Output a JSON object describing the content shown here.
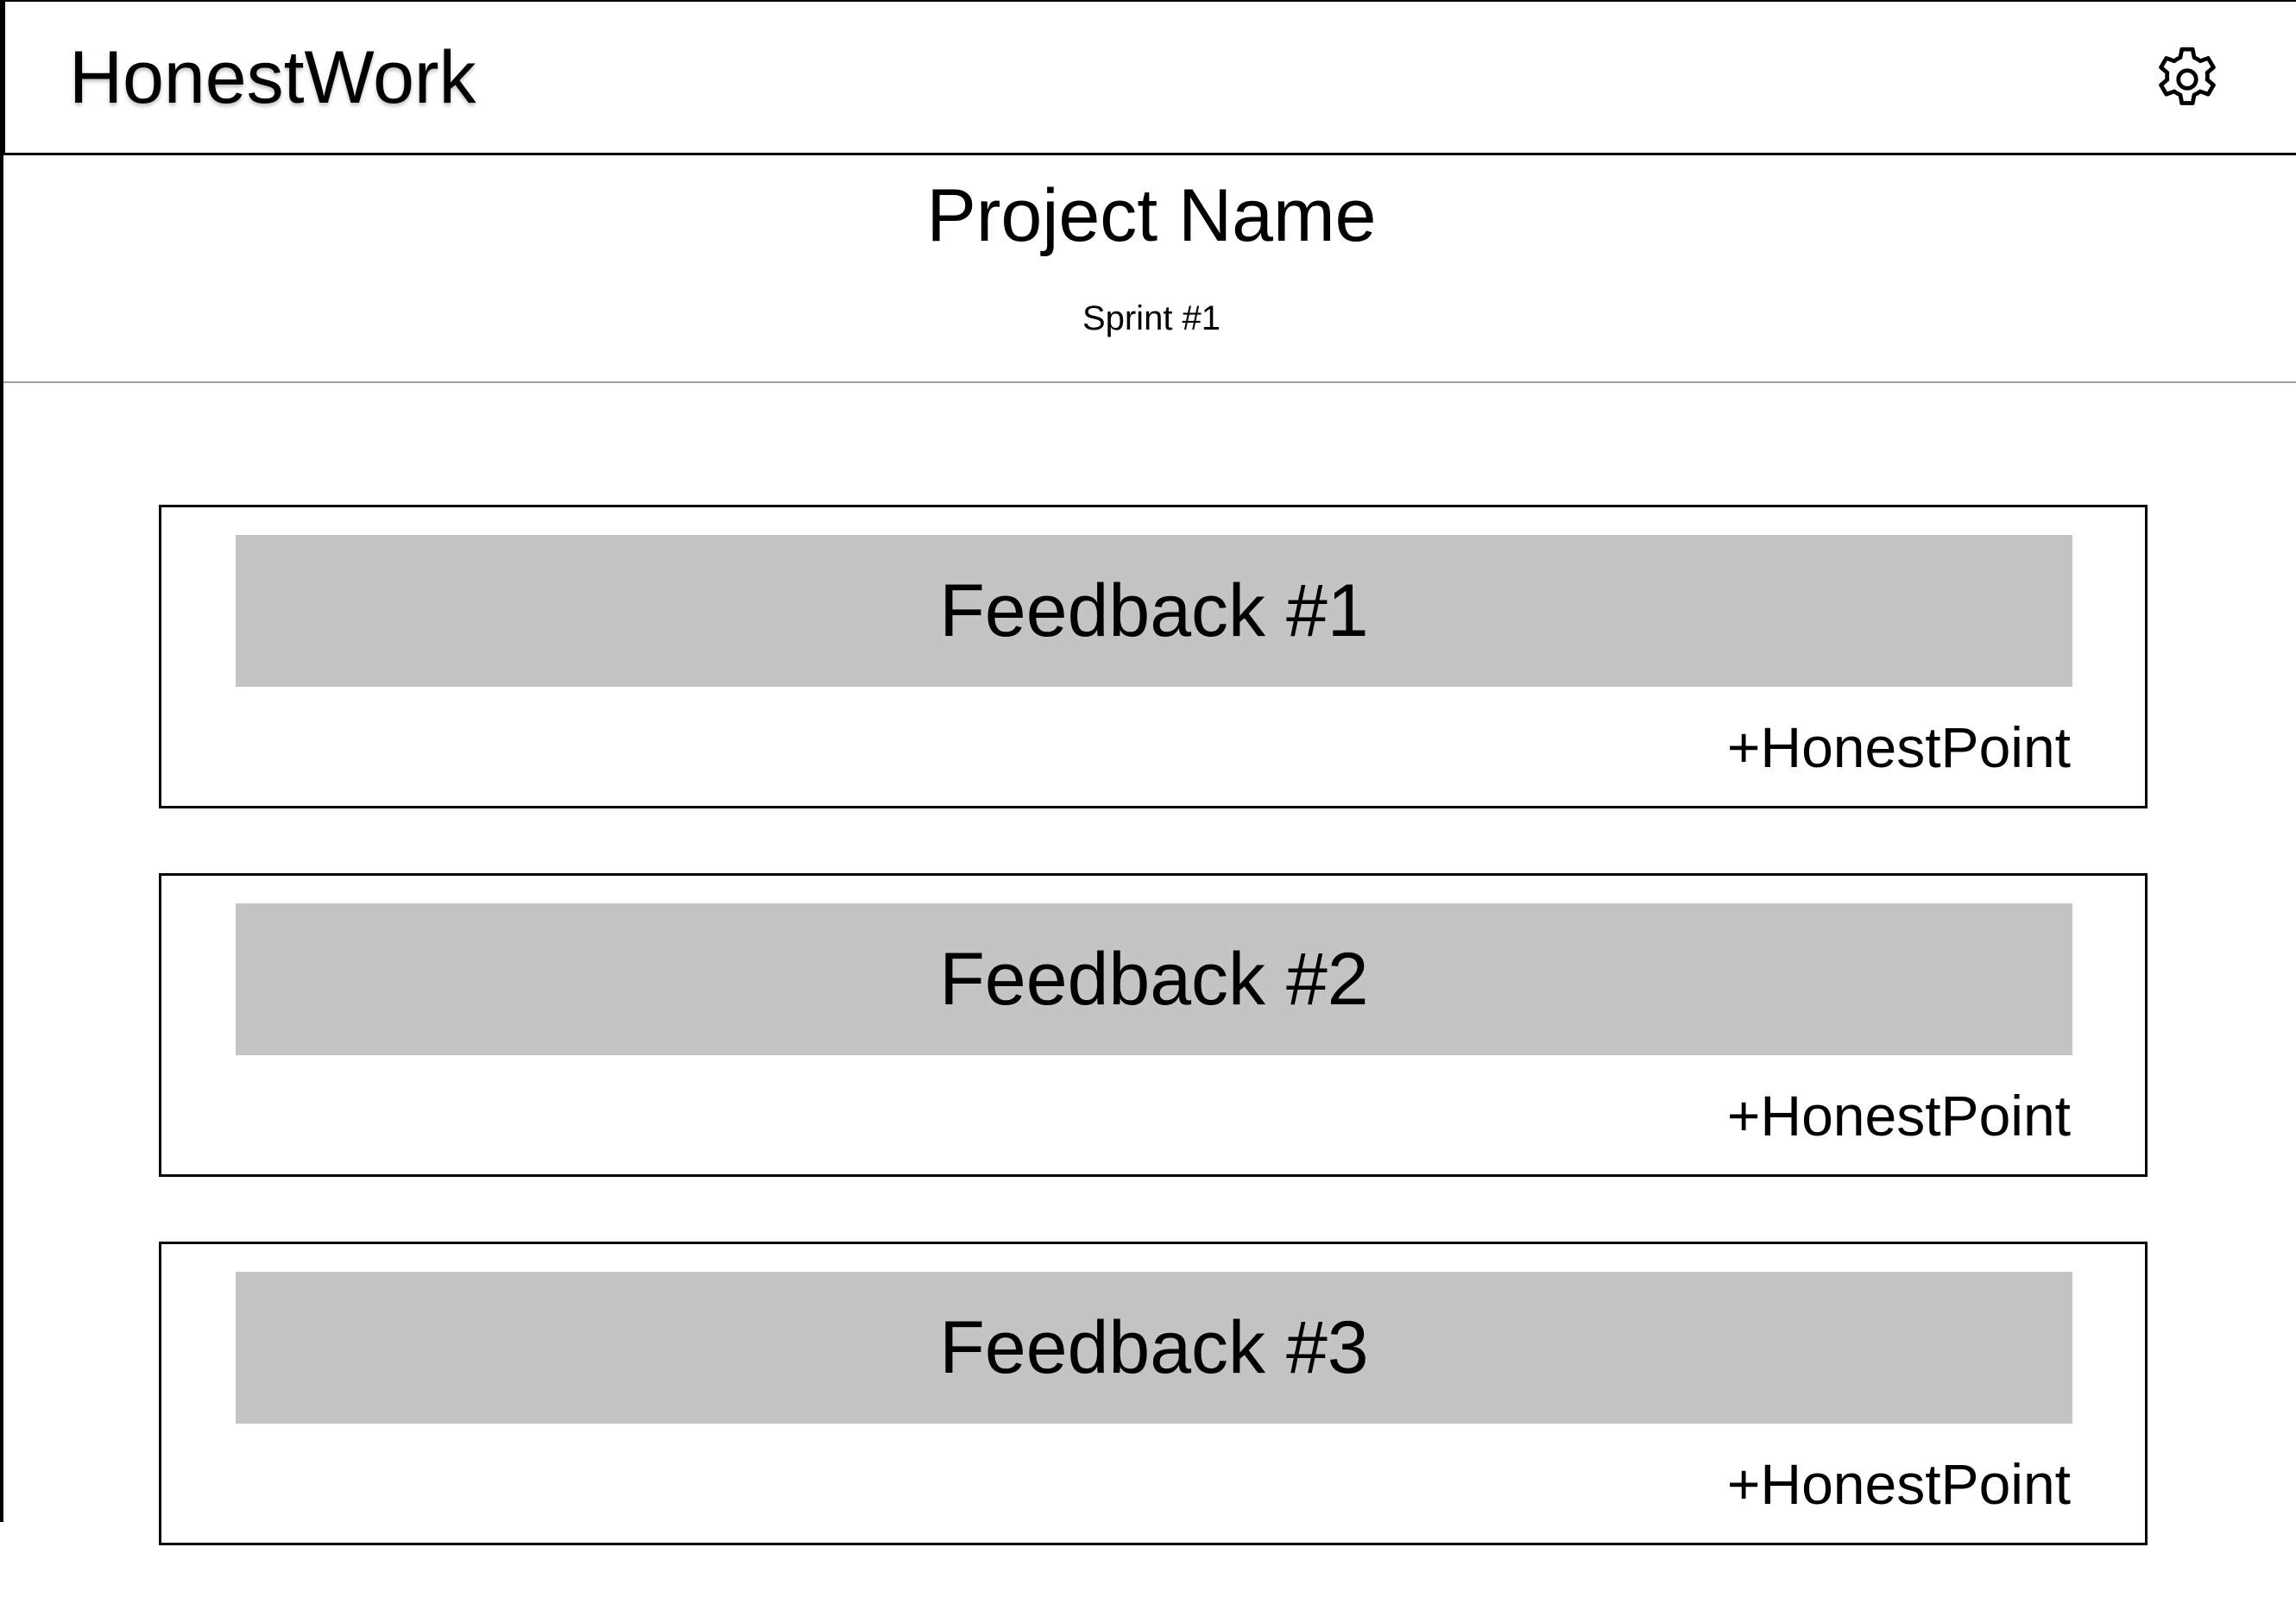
{
  "app": {
    "title": "HonestWork",
    "settings_icon": "gear-icon"
  },
  "project": {
    "name": "Project Name",
    "sprint": "Sprint #1"
  },
  "feedback": [
    {
      "title": "Feedback #1",
      "action": "+HonestPoint"
    },
    {
      "title": "Feedback #2",
      "action": "+HonestPoint"
    },
    {
      "title": "Feedback #3",
      "action": "+HonestPoint"
    }
  ],
  "colors": {
    "feedback_bar": "#c4c4c4",
    "border": "#000000",
    "divider": "#a0a0a0"
  }
}
